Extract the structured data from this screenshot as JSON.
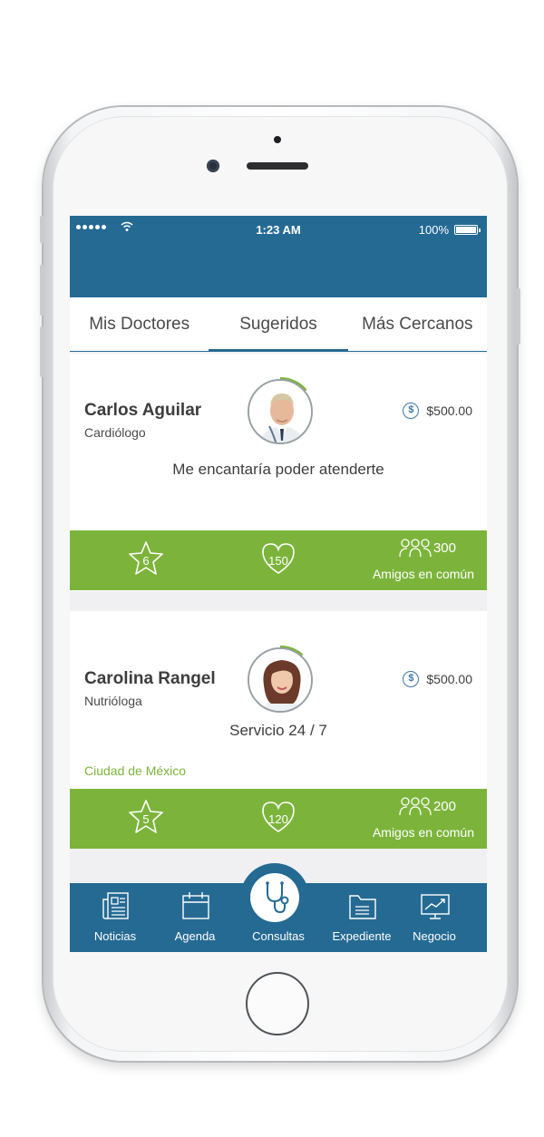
{
  "status_bar": {
    "time": "1:23 AM",
    "battery": "100%"
  },
  "tabs": [
    {
      "label": "Mis Doctores",
      "active": false
    },
    {
      "label": "Sugeridos",
      "active": true
    },
    {
      "label": "Más Cercanos",
      "active": false
    }
  ],
  "doctors": [
    {
      "name": "Carlos Aguilar",
      "specialty": "Cardiólogo",
      "price": "$500.00",
      "message": "Me encantaría poder atenderte",
      "city": "",
      "rating": "6",
      "likes": "150",
      "friends": "300",
      "friends_label": "Amigos en común"
    },
    {
      "name": "Carolina Rangel",
      "specialty": "Nutrióloga",
      "price": "$500.00",
      "message": "Servicio 24 / 7",
      "city": "Ciudad de México",
      "rating": "5",
      "likes": "120",
      "friends": "200",
      "friends_label": "Amigos en común"
    }
  ],
  "tabbar": [
    {
      "label": "Noticias",
      "icon": "newspaper-icon"
    },
    {
      "label": "Agenda",
      "icon": "calendar-icon"
    },
    {
      "label": "Consultas",
      "icon": "stethoscope-icon"
    },
    {
      "label": "Expediente",
      "icon": "folder-icon"
    },
    {
      "label": "Negocio",
      "icon": "chart-icon"
    }
  ],
  "colors": {
    "primary": "#246a93",
    "accent_green": "#7cb43b",
    "white": "#ffffff"
  }
}
